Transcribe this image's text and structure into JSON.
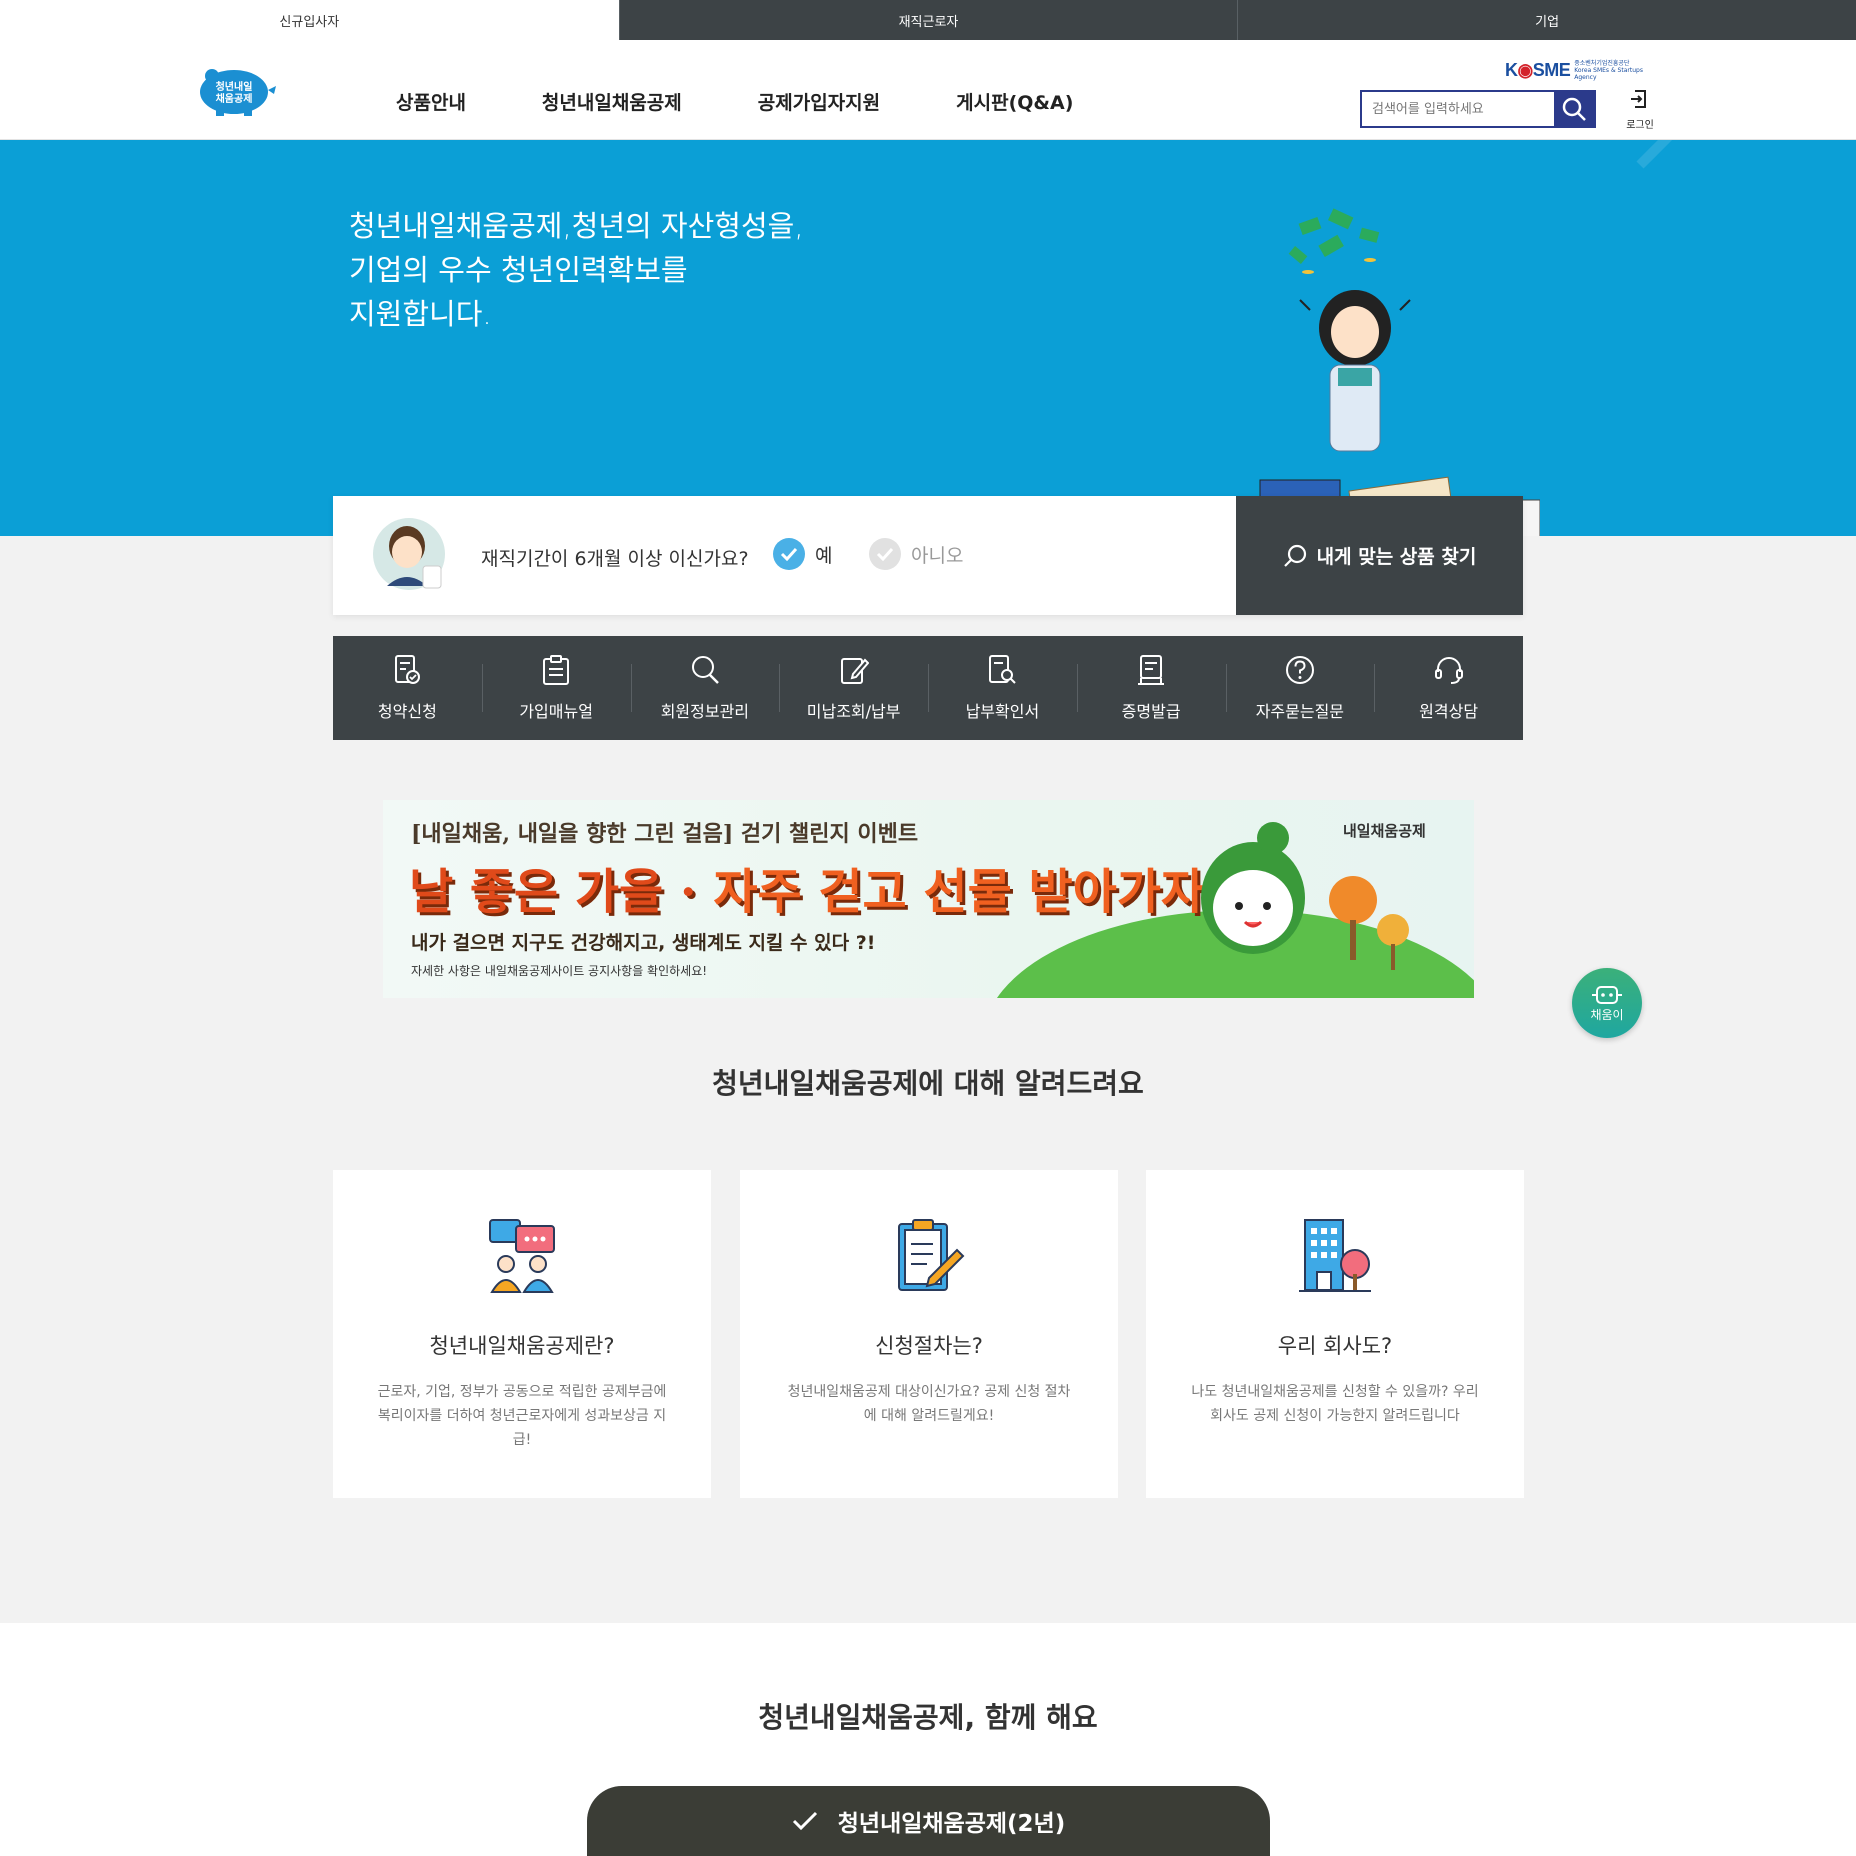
{
  "audience_tabs": [
    {
      "label": "신규입사자",
      "active": true
    },
    {
      "label": "재직근로자",
      "active": false
    },
    {
      "label": "기업",
      "active": false
    }
  ],
  "header": {
    "logo_text": "청년내일 채움공제",
    "nav": [
      "상품안내",
      "청년내일채움공제",
      "공제가입자지원",
      "게시판(Q&A)"
    ],
    "kosme": {
      "mark_a": "K",
      "mark_b": "SME",
      "sub": "중소벤처기업진흥공단 Korea SMEs & Startups Agency"
    },
    "search_placeholder": "검색어를 입력하세요",
    "login_label": "로그인"
  },
  "hero": {
    "lines": [
      "청년내일채움공제,청년의 자산형성을,",
      "기업의 우수 청년인력확보를",
      "지원합니다."
    ]
  },
  "question": {
    "text": "재직기간이 6개월 이상 이신가요?",
    "yes": "예",
    "no": "아니오",
    "selected": "yes",
    "find_button": "내게 맞는 상품 찾기"
  },
  "quick_menu": [
    {
      "label": "청약신청",
      "icon": "document-check-icon"
    },
    {
      "label": "가입매뉴얼",
      "icon": "clipboard-icon"
    },
    {
      "label": "회원정보관리",
      "icon": "search-icon"
    },
    {
      "label": "미납조회/납부",
      "icon": "edit-icon"
    },
    {
      "label": "납부확인서",
      "icon": "document-search-icon"
    },
    {
      "label": "증명발급",
      "icon": "certificate-icon"
    },
    {
      "label": "자주묻는질문",
      "icon": "question-icon"
    },
    {
      "label": "원격상담",
      "icon": "headset-icon"
    }
  ],
  "banner": {
    "line1": "[내일채움, 내일을 향한 그린 걸음] 걷기 챌린지 이벤트",
    "line2a": "날 좋은 가을 · ",
    "line2b": "자주 걷고 선물 받아가자!",
    "line3": "내가 걸으면 지구도 건강해지고, 생태계도 지킬 수 있다 ?!",
    "line4": "자세한 사항은 내일채움공제사이트 공지사항을 확인하세요!",
    "logo": "내일채움공제"
  },
  "chatbot_label": "채움이",
  "about": {
    "title": "청년내일채움공제에 대해 알려드려요",
    "cards": [
      {
        "title": "청년내일채움공제란?",
        "desc": "근로자, 기업, 정부가 공동으로 적립한 공제부금에 복리이자를 더하여 청년근로자에게 성과보상금 지급!",
        "icon": "people-chat-icon"
      },
      {
        "title": "신청절차는?",
        "desc": "청년내일채움공제 대상이신가요? 공제 신청 절차에 대해 알려드릴게요!",
        "icon": "clipboard-pen-icon"
      },
      {
        "title": "우리 회사도?",
        "desc": "나도 청년내일채움공제를 신청할 수 있을까? 우리 회사도 공제 신청이 가능한지 알려드립니다",
        "icon": "building-tree-icon"
      }
    ]
  },
  "together": {
    "title": "청년내일채움공제, 함께 해요",
    "pill": "청년내일채움공제(2년)"
  },
  "colors": {
    "hero_bg": "#0b9fd6",
    "dark": "#3d4346",
    "accent_check": "#4ab0e6",
    "search_border": "#2b3a8b"
  }
}
